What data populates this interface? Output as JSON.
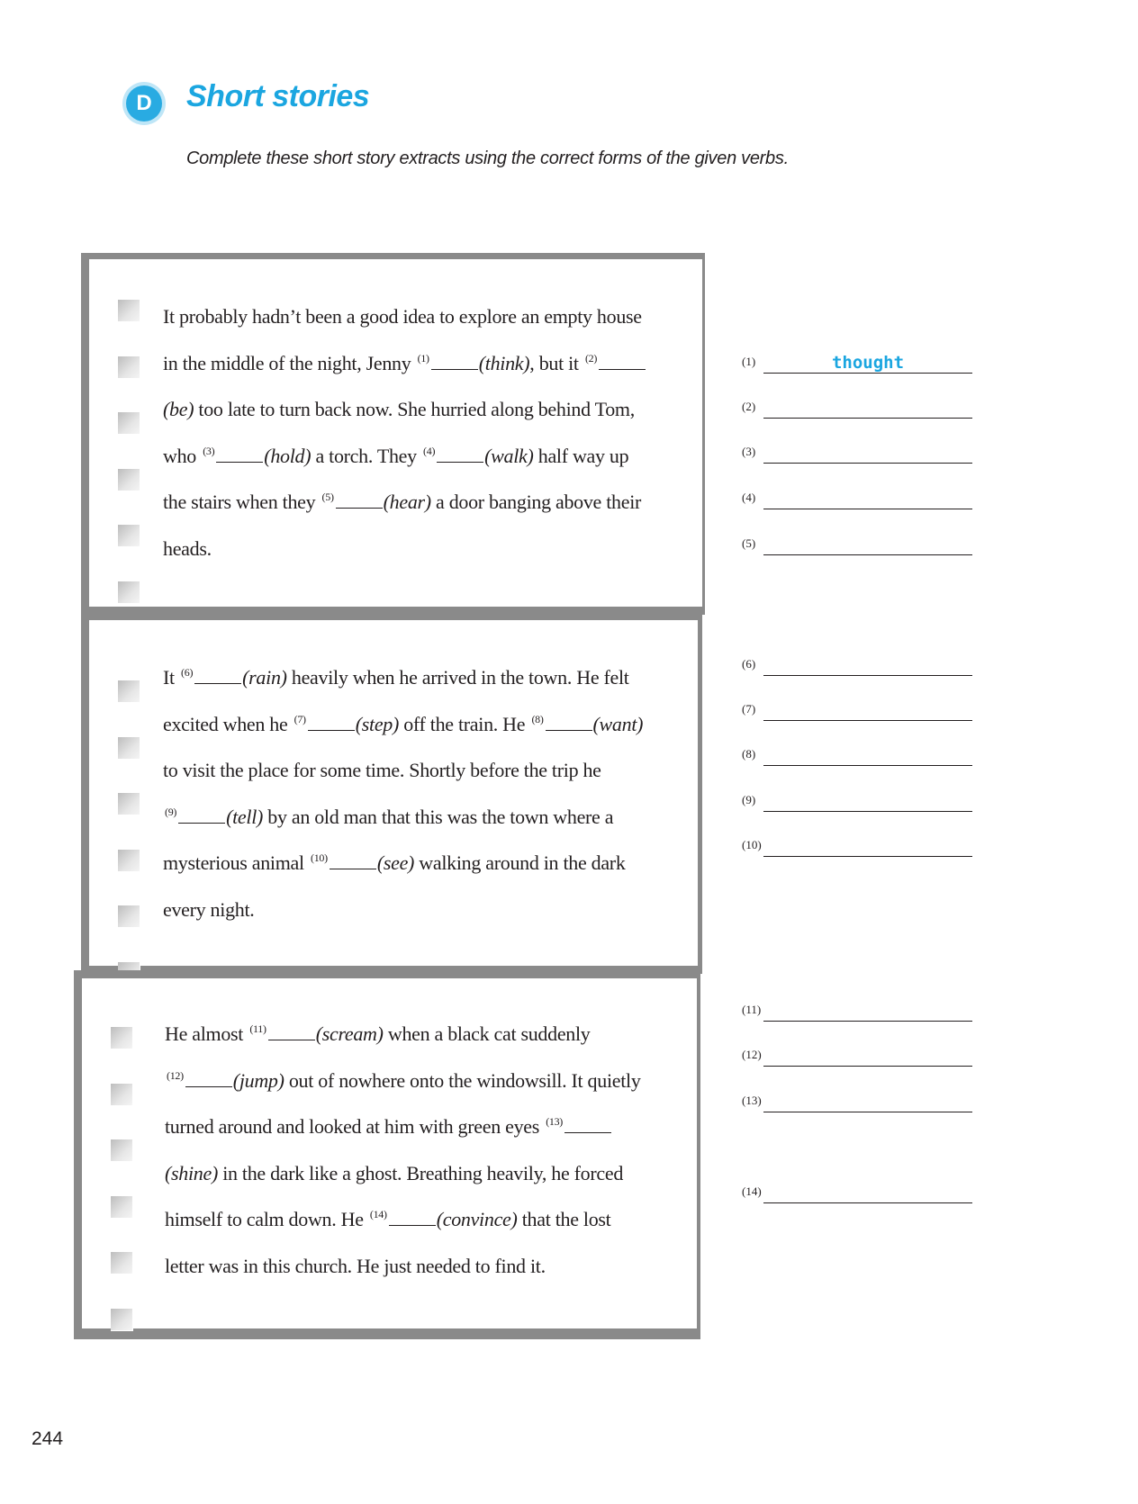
{
  "section": {
    "letter": "D",
    "title": "Short stories"
  },
  "instructions": "Complete these short story extracts using the correct forms of the given verbs.",
  "stories": [
    [
      [
        {
          "t": "It probably hadn’t been a good idea to explore an empty house"
        }
      ],
      [
        {
          "t": "in the middle of the night, Jenny "
        },
        {
          "n": "(1)"
        },
        {
          "b": true
        },
        {
          "i": "(think)"
        },
        {
          "t": ", but it "
        },
        {
          "n": "(2)"
        },
        {
          "b": true
        }
      ],
      [
        {
          "i": "(be)"
        },
        {
          "t": " too late to turn back now. She hurried along behind Tom,"
        }
      ],
      [
        {
          "t": "who "
        },
        {
          "n": "(3)"
        },
        {
          "b": true
        },
        {
          "i": "(hold)"
        },
        {
          "t": " a torch. They "
        },
        {
          "n": "(4)"
        },
        {
          "b": true
        },
        {
          "i": "(walk)"
        },
        {
          "t": " half way up"
        }
      ],
      [
        {
          "t": "the stairs when they "
        },
        {
          "n": "(5)"
        },
        {
          "b": true
        },
        {
          "i": "(hear)"
        },
        {
          "t": " a door banging above their"
        }
      ],
      [
        {
          "t": "heads."
        }
      ]
    ],
    [
      [
        {
          "t": "It "
        },
        {
          "n": "(6)"
        },
        {
          "b": true
        },
        {
          "i": "(rain)"
        },
        {
          "t": " heavily when he arrived in the town. He felt"
        }
      ],
      [
        {
          "t": "excited when he "
        },
        {
          "n": "(7)"
        },
        {
          "b": true
        },
        {
          "i": "(step)"
        },
        {
          "t": " off the train. He "
        },
        {
          "n": "(8)"
        },
        {
          "b": true
        },
        {
          "i": "(want)"
        }
      ],
      [
        {
          "t": "to visit the place for some time. Shortly before the trip he"
        }
      ],
      [
        {
          "n": "(9)"
        },
        {
          "b": true
        },
        {
          "i": "(tell)"
        },
        {
          "t": " by an old man that this was the town where a"
        }
      ],
      [
        {
          "t": "mysterious animal "
        },
        {
          "n": "(10)"
        },
        {
          "b": true
        },
        {
          "i": "(see)"
        },
        {
          "t": " walking around in the dark"
        }
      ],
      [
        {
          "t": "every night."
        }
      ]
    ],
    [
      [
        {
          "t": "He almost "
        },
        {
          "n": "(11)"
        },
        {
          "b": true
        },
        {
          "i": "(scream)"
        },
        {
          "t": " when a black cat suddenly"
        }
      ],
      [
        {
          "n": "(12)"
        },
        {
          "b": true
        },
        {
          "i": "(jump)"
        },
        {
          "t": " out of nowhere onto the windowsill. It quietly"
        }
      ],
      [
        {
          "t": "turned around and looked at him with green eyes "
        },
        {
          "n": "(13)"
        },
        {
          "b": true
        }
      ],
      [
        {
          "i": "(shine)"
        },
        {
          "t": " in the dark like a ghost. Breathing heavily, he forced"
        }
      ],
      [
        {
          "t": "himself to calm down. He "
        },
        {
          "n": "(14)"
        },
        {
          "b": true
        },
        {
          "i": "(convince)"
        },
        {
          "t": " that the lost"
        }
      ],
      [
        {
          "t": "letter was in this church. He just needed to find it."
        }
      ]
    ]
  ],
  "answers": [
    {
      "num": "(1)",
      "value": "thought"
    },
    {
      "num": "(2)",
      "value": ""
    },
    {
      "num": "(3)",
      "value": ""
    },
    {
      "num": "(4)",
      "value": ""
    },
    {
      "num": "(5)",
      "value": ""
    },
    {
      "num": "(6)",
      "value": ""
    },
    {
      "num": "(7)",
      "value": ""
    },
    {
      "num": "(8)",
      "value": ""
    },
    {
      "num": "(9)",
      "value": ""
    },
    {
      "num": "(10)",
      "value": ""
    },
    {
      "num": "(11)",
      "value": ""
    },
    {
      "num": "(12)",
      "value": ""
    },
    {
      "num": "(13)",
      "value": ""
    },
    {
      "num": "(14)",
      "value": ""
    }
  ],
  "page_number": "244",
  "colors": {
    "accent": "#1ba6e0",
    "card_border": "#8a8a8a",
    "answer_text": "#1ba6e0"
  }
}
